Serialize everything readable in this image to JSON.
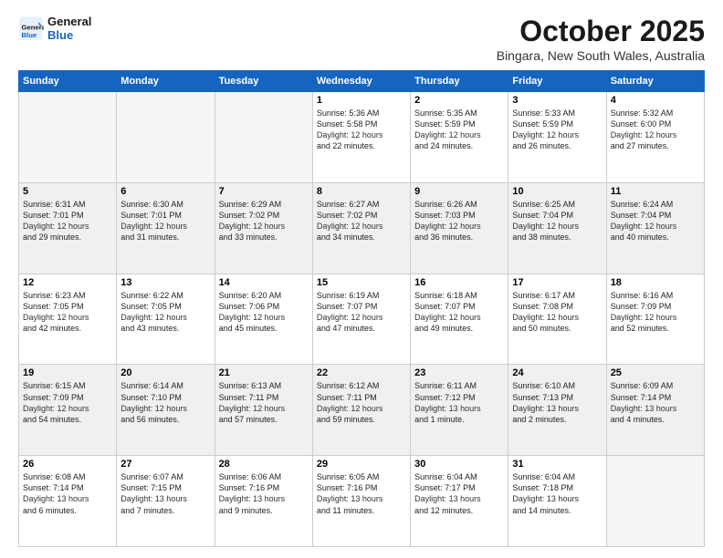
{
  "header": {
    "logo_line1": "General",
    "logo_line2": "Blue",
    "month": "October 2025",
    "location": "Bingara, New South Wales, Australia"
  },
  "days_of_week": [
    "Sunday",
    "Monday",
    "Tuesday",
    "Wednesday",
    "Thursday",
    "Friday",
    "Saturday"
  ],
  "weeks": [
    [
      {
        "day": "",
        "content": ""
      },
      {
        "day": "",
        "content": ""
      },
      {
        "day": "",
        "content": ""
      },
      {
        "day": "1",
        "content": "Sunrise: 5:36 AM\nSunset: 5:58 PM\nDaylight: 12 hours\nand 22 minutes."
      },
      {
        "day": "2",
        "content": "Sunrise: 5:35 AM\nSunset: 5:59 PM\nDaylight: 12 hours\nand 24 minutes."
      },
      {
        "day": "3",
        "content": "Sunrise: 5:33 AM\nSunset: 5:59 PM\nDaylight: 12 hours\nand 26 minutes."
      },
      {
        "day": "4",
        "content": "Sunrise: 5:32 AM\nSunset: 6:00 PM\nDaylight: 12 hours\nand 27 minutes."
      }
    ],
    [
      {
        "day": "5",
        "content": "Sunrise: 6:31 AM\nSunset: 7:01 PM\nDaylight: 12 hours\nand 29 minutes."
      },
      {
        "day": "6",
        "content": "Sunrise: 6:30 AM\nSunset: 7:01 PM\nDaylight: 12 hours\nand 31 minutes."
      },
      {
        "day": "7",
        "content": "Sunrise: 6:29 AM\nSunset: 7:02 PM\nDaylight: 12 hours\nand 33 minutes."
      },
      {
        "day": "8",
        "content": "Sunrise: 6:27 AM\nSunset: 7:02 PM\nDaylight: 12 hours\nand 34 minutes."
      },
      {
        "day": "9",
        "content": "Sunrise: 6:26 AM\nSunset: 7:03 PM\nDaylight: 12 hours\nand 36 minutes."
      },
      {
        "day": "10",
        "content": "Sunrise: 6:25 AM\nSunset: 7:04 PM\nDaylight: 12 hours\nand 38 minutes."
      },
      {
        "day": "11",
        "content": "Sunrise: 6:24 AM\nSunset: 7:04 PM\nDaylight: 12 hours\nand 40 minutes."
      }
    ],
    [
      {
        "day": "12",
        "content": "Sunrise: 6:23 AM\nSunset: 7:05 PM\nDaylight: 12 hours\nand 42 minutes."
      },
      {
        "day": "13",
        "content": "Sunrise: 6:22 AM\nSunset: 7:05 PM\nDaylight: 12 hours\nand 43 minutes."
      },
      {
        "day": "14",
        "content": "Sunrise: 6:20 AM\nSunset: 7:06 PM\nDaylight: 12 hours\nand 45 minutes."
      },
      {
        "day": "15",
        "content": "Sunrise: 6:19 AM\nSunset: 7:07 PM\nDaylight: 12 hours\nand 47 minutes."
      },
      {
        "day": "16",
        "content": "Sunrise: 6:18 AM\nSunset: 7:07 PM\nDaylight: 12 hours\nand 49 minutes."
      },
      {
        "day": "17",
        "content": "Sunrise: 6:17 AM\nSunset: 7:08 PM\nDaylight: 12 hours\nand 50 minutes."
      },
      {
        "day": "18",
        "content": "Sunrise: 6:16 AM\nSunset: 7:09 PM\nDaylight: 12 hours\nand 52 minutes."
      }
    ],
    [
      {
        "day": "19",
        "content": "Sunrise: 6:15 AM\nSunset: 7:09 PM\nDaylight: 12 hours\nand 54 minutes."
      },
      {
        "day": "20",
        "content": "Sunrise: 6:14 AM\nSunset: 7:10 PM\nDaylight: 12 hours\nand 56 minutes."
      },
      {
        "day": "21",
        "content": "Sunrise: 6:13 AM\nSunset: 7:11 PM\nDaylight: 12 hours\nand 57 minutes."
      },
      {
        "day": "22",
        "content": "Sunrise: 6:12 AM\nSunset: 7:11 PM\nDaylight: 12 hours\nand 59 minutes."
      },
      {
        "day": "23",
        "content": "Sunrise: 6:11 AM\nSunset: 7:12 PM\nDaylight: 13 hours\nand 1 minute."
      },
      {
        "day": "24",
        "content": "Sunrise: 6:10 AM\nSunset: 7:13 PM\nDaylight: 13 hours\nand 2 minutes."
      },
      {
        "day": "25",
        "content": "Sunrise: 6:09 AM\nSunset: 7:14 PM\nDaylight: 13 hours\nand 4 minutes."
      }
    ],
    [
      {
        "day": "26",
        "content": "Sunrise: 6:08 AM\nSunset: 7:14 PM\nDaylight: 13 hours\nand 6 minutes."
      },
      {
        "day": "27",
        "content": "Sunrise: 6:07 AM\nSunset: 7:15 PM\nDaylight: 13 hours\nand 7 minutes."
      },
      {
        "day": "28",
        "content": "Sunrise: 6:06 AM\nSunset: 7:16 PM\nDaylight: 13 hours\nand 9 minutes."
      },
      {
        "day": "29",
        "content": "Sunrise: 6:05 AM\nSunset: 7:16 PM\nDaylight: 13 hours\nand 11 minutes."
      },
      {
        "day": "30",
        "content": "Sunrise: 6:04 AM\nSunset: 7:17 PM\nDaylight: 13 hours\nand 12 minutes."
      },
      {
        "day": "31",
        "content": "Sunrise: 6:04 AM\nSunset: 7:18 PM\nDaylight: 13 hours\nand 14 minutes."
      },
      {
        "day": "",
        "content": ""
      }
    ]
  ]
}
